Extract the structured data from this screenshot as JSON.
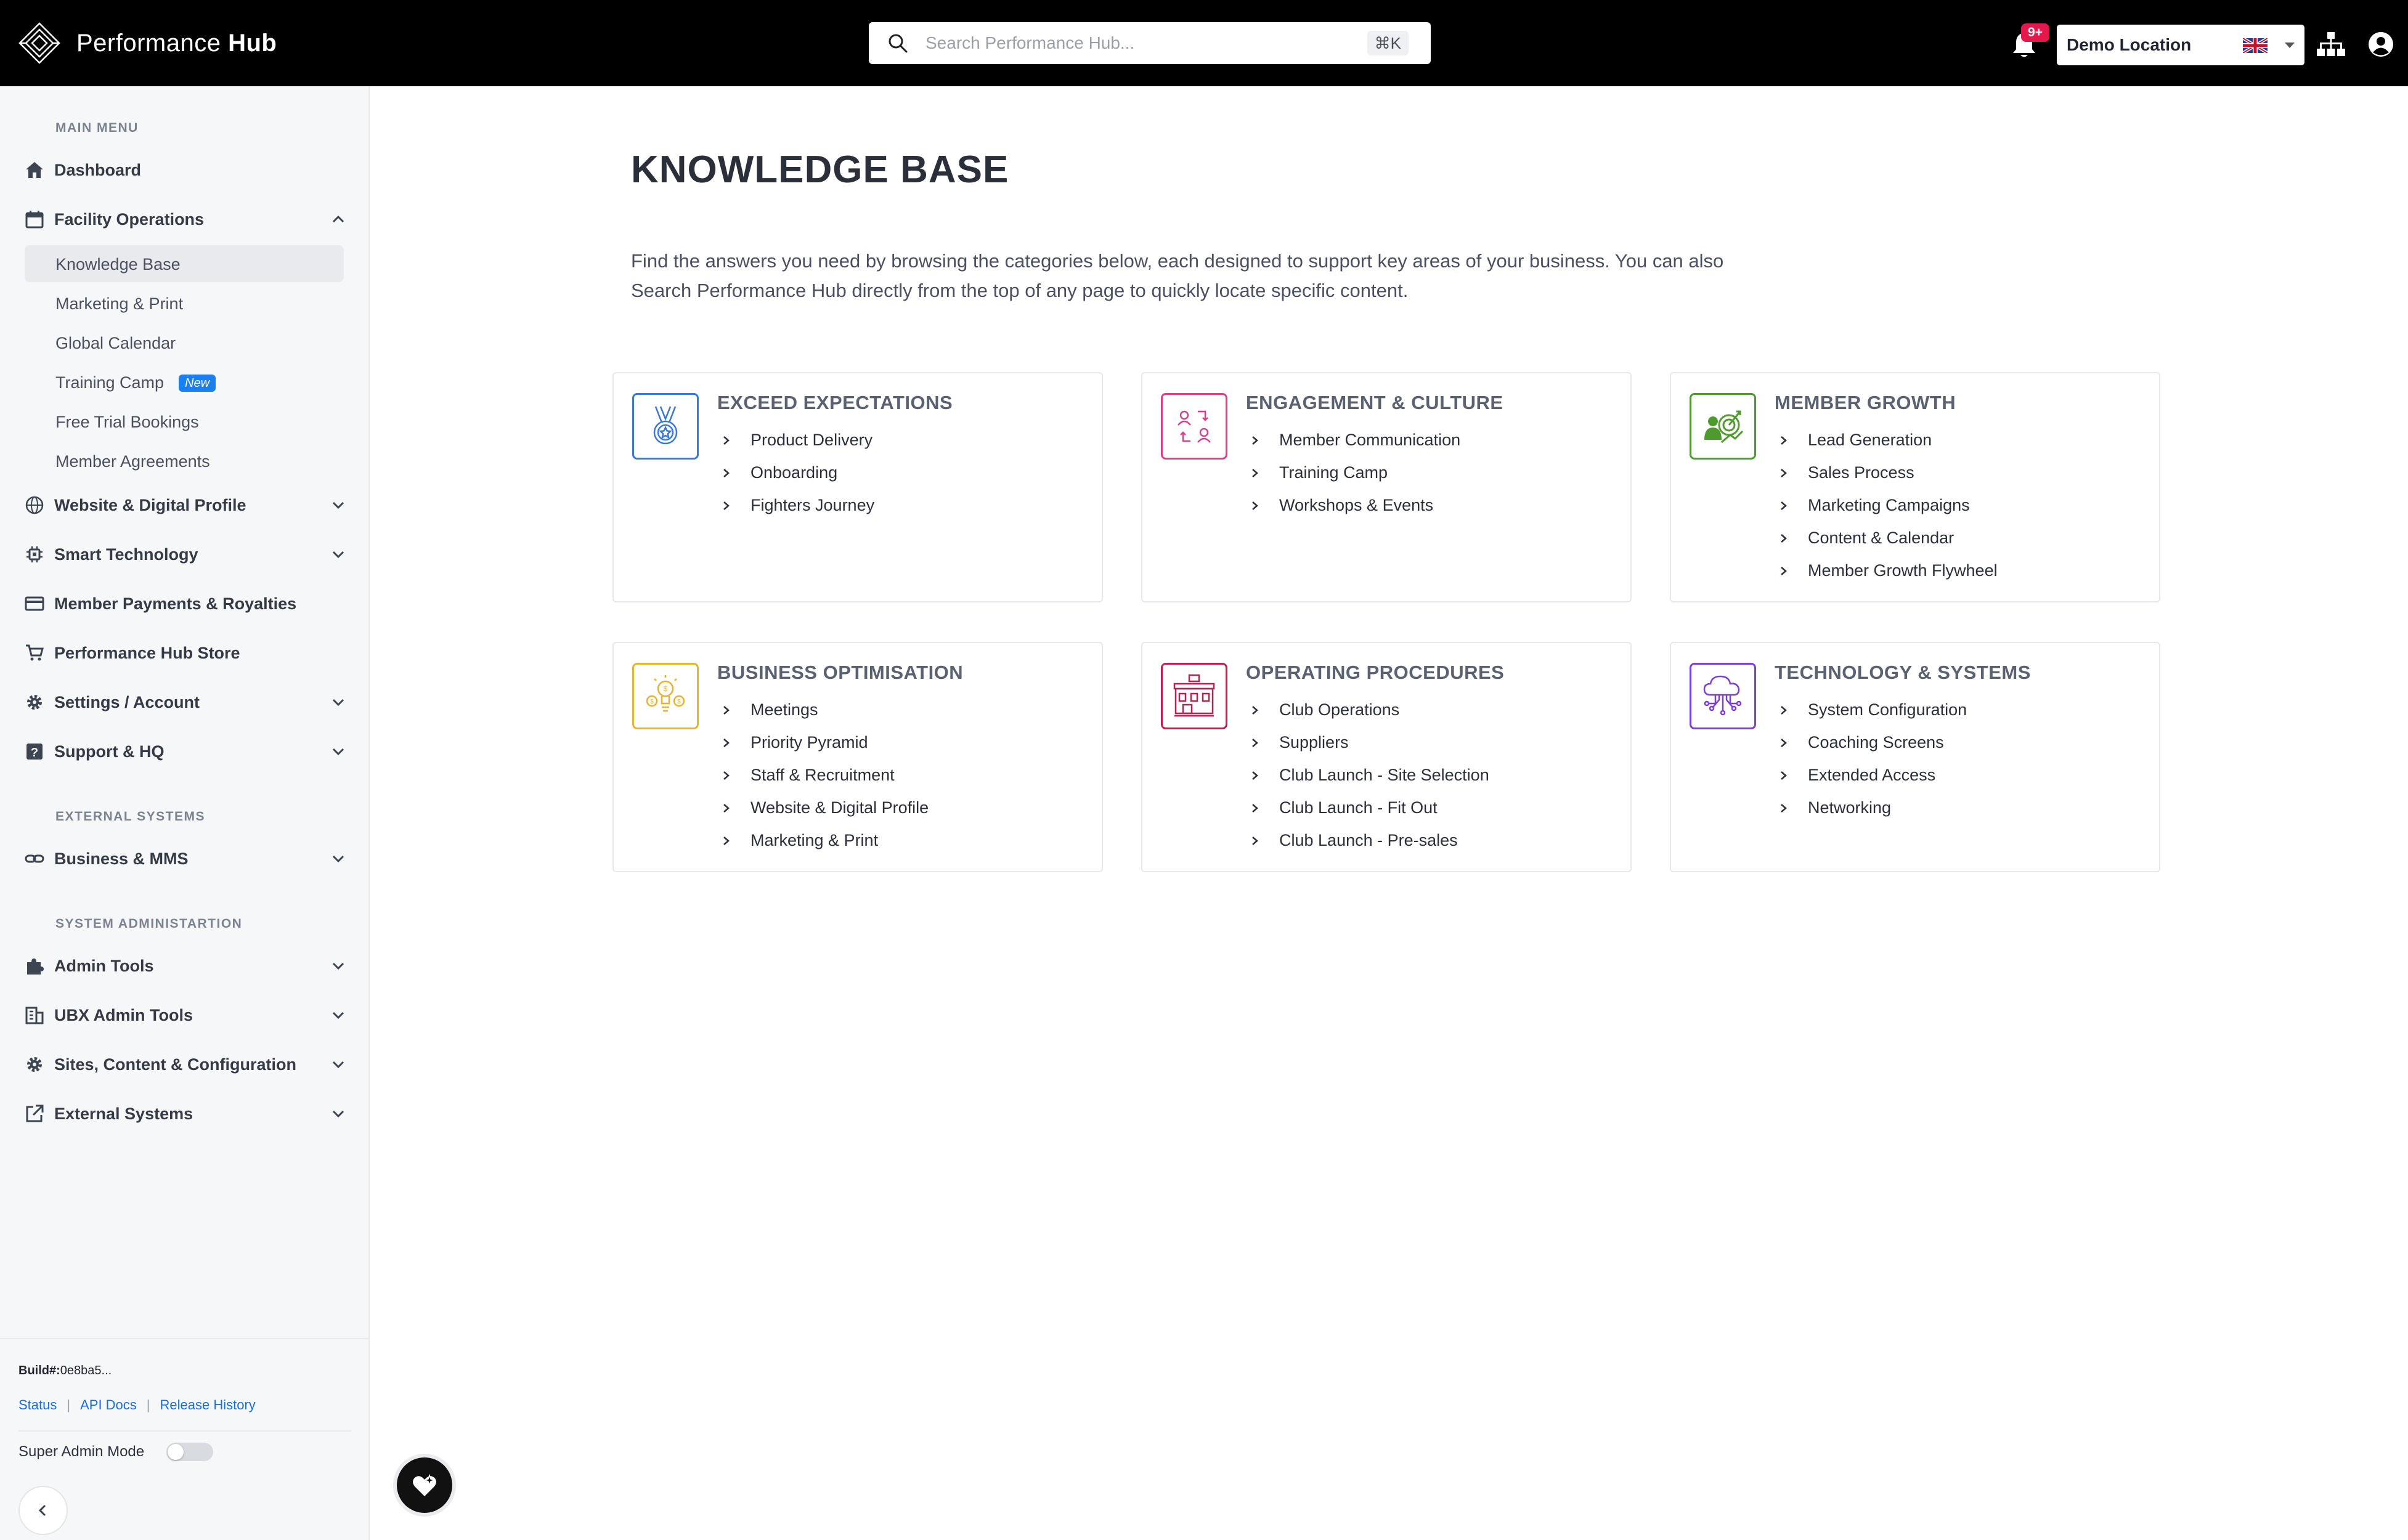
{
  "header": {
    "logo_text": "Performance",
    "logo_text_bold": "Hub",
    "search_placeholder": "Search Performance Hub...",
    "search_shortcut": "⌘K",
    "notification_count": "9+",
    "location": "Demo Location"
  },
  "sidebar": {
    "main_menu_title": "MAIN MENU",
    "dashboard": "Dashboard",
    "facility_operations": "Facility Operations",
    "facility_sub": [
      "Knowledge Base",
      "Marketing & Print",
      "Global Calendar",
      "Training Camp",
      "Free Trial Bookings",
      "Member Agreements"
    ],
    "new_badge": "New",
    "website_digital": "Website & Digital Profile",
    "smart_technology": "Smart Technology",
    "member_payments": "Member Payments & Royalties",
    "store": "Performance Hub Store",
    "settings": "Settings / Account",
    "support": "Support & HQ",
    "external_title": "EXTERNAL SYSTEMS",
    "business_mms": "Business & MMS",
    "sysadmin_title": "SYSTEM ADMINISTARTION",
    "admin_tools": "Admin Tools",
    "ubx_admin_tools": "UBX Admin Tools",
    "sites_content": "Sites, Content & Configuration",
    "external_systems": "External Systems"
  },
  "footer": {
    "build_label": "Build#:",
    "build_value": "0e8ba5...",
    "links": [
      "Status",
      "API Docs",
      "Release History"
    ],
    "super_admin": "Super Admin Mode"
  },
  "main": {
    "title": "KNOWLEDGE BASE",
    "intro_1": "Find the answers you need by browsing the categories below, each designed to support key areas of your business. You can also",
    "intro_2": "Search Performance Hub directly from the top of any page to quickly locate specific content."
  },
  "cards": [
    {
      "title": "EXCEED EXPECTATIONS",
      "icon": "medal-icon",
      "color": "#3a78d8",
      "links": [
        "Product Delivery",
        "Onboarding",
        "Fighters Journey"
      ]
    },
    {
      "title": "ENGAGEMENT & CULTURE",
      "icon": "people-exchange-icon",
      "color": "#d6418a",
      "links": [
        "Member Communication",
        "Training Camp",
        "Workshops & Events"
      ]
    },
    {
      "title": "MEMBER GROWTH",
      "icon": "target-growth-icon",
      "color": "#4f9a2e",
      "links": [
        "Lead Generation",
        "Sales Process",
        "Marketing Campaigns",
        "Content & Calendar",
        "Member Growth Flywheel"
      ]
    },
    {
      "title": "BUSINESS OPTIMISATION",
      "icon": "lightbulb-money-icon",
      "color": "#e5b430",
      "links": [
        "Meetings",
        "Priority Pyramid",
        "Staff & Recruitment",
        "Website & Digital Profile",
        "Marketing & Print"
      ]
    },
    {
      "title": "OPERATING PROCEDURES",
      "icon": "storefront-icon",
      "color": "#b8224f",
      "links": [
        "Club Operations",
        "Suppliers",
        "Club Launch - Site Selection",
        "Club Launch - Fit Out",
        "Club Launch - Pre-sales"
      ]
    },
    {
      "title": "TECHNOLOGY & SYSTEMS",
      "icon": "cloud-network-icon",
      "color": "#7b3fd6",
      "links": [
        "System Configuration",
        "Coaching Screens",
        "Extended Access",
        "Networking"
      ]
    }
  ]
}
